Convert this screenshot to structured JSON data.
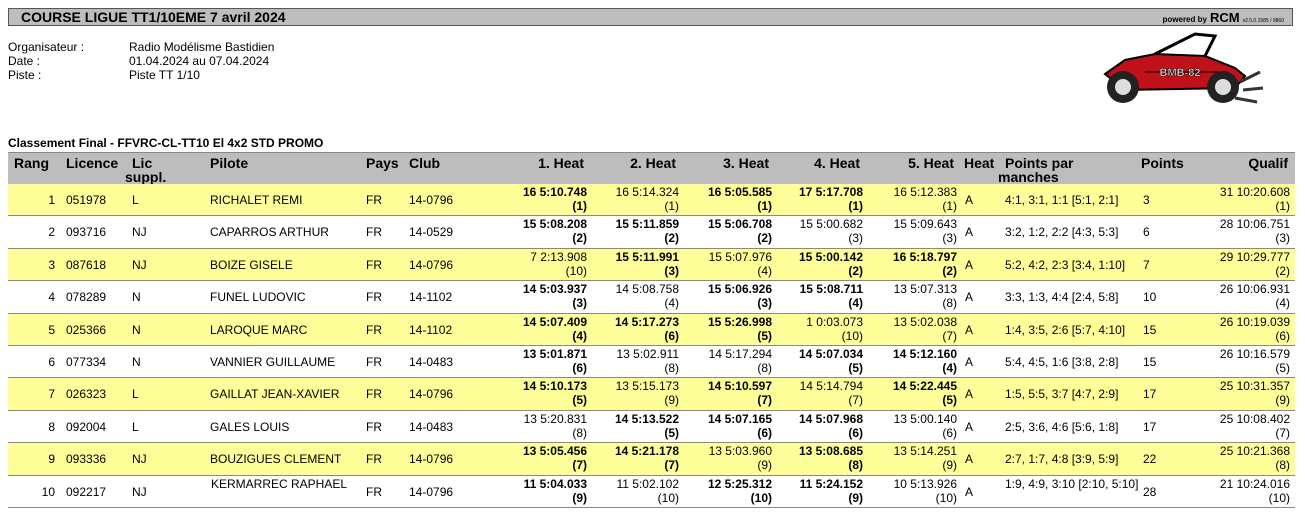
{
  "header": {
    "title": "COURSE LIGUE TT1/10EME 7 avril 2024",
    "powered_by": "powered by",
    "brand": "RCM",
    "version": "v2.5.0.1585 / 9860"
  },
  "info": {
    "organisateur_label": "Organisateur :",
    "organisateur": "Radio Modélisme Bastidien",
    "date_label": "Date :",
    "date": "01.04.2024 au 07.04.2024",
    "piste_label": "Piste :",
    "piste": "Piste TT 1/10"
  },
  "logo": {
    "text": "BMB-82"
  },
  "subtitle": "Classement Final  -  FFVRC-CL-TT10 El 4x2 STD PROMO",
  "columns": {
    "rang": "Rang",
    "licence": "Licence",
    "lic_suppl_1": "Lic",
    "lic_suppl_2": "suppl.",
    "pilote": "Pilote",
    "pays": "Pays",
    "club": "Club",
    "heat1": "1. Heat",
    "heat2": "2. Heat",
    "heat3": "3. Heat",
    "heat4": "4. Heat",
    "heat5": "5. Heat",
    "heat": "Heat",
    "points_par_1": "Points par",
    "points_par_2": "manches",
    "points": "Points",
    "qualif": "Qualif"
  },
  "rows": [
    {
      "rang": "1",
      "licence": "051978",
      "lic": "L",
      "pilote": "RICHALET REMI",
      "pays": "FR",
      "club": "14-0796",
      "heats": [
        [
          "16 5:10.748",
          "(1)"
        ],
        [
          "16 5:14.324",
          "(1)"
        ],
        [
          "16 5:05.585",
          "(1)"
        ],
        [
          "17 5:17.708",
          "(1)"
        ],
        [
          "16 5:12.383",
          "(1)"
        ]
      ],
      "heat": "A",
      "pts": "4:1, 3:1, 1:1 [5:1, 2:1]",
      "points": "3",
      "qualif": [
        "31 10:20.608",
        "(1)"
      ]
    },
    {
      "rang": "2",
      "licence": "093716",
      "lic": "NJ",
      "pilote": "CAPARROS ARTHUR",
      "pays": "FR",
      "club": "14-0529",
      "heats": [
        [
          "15 5:08.208",
          "(2)"
        ],
        [
          "15 5:11.859",
          "(2)"
        ],
        [
          "15 5:06.708",
          "(2)"
        ],
        [
          "15 5:00.682",
          "(3)"
        ],
        [
          "15 5:09.643",
          "(3)"
        ]
      ],
      "heat": "A",
      "pts": "3:2, 1:2, 2:2 [4:3, 5:3]",
      "points": "6",
      "qualif": [
        "28 10:06.751",
        "(3)"
      ]
    },
    {
      "rang": "3",
      "licence": "087618",
      "lic": "NJ",
      "pilote": "BOIZE GISELE",
      "pays": "FR",
      "club": "14-0796",
      "heats": [
        [
          "7 2:13.908",
          "(10)"
        ],
        [
          "15 5:11.991",
          "(3)"
        ],
        [
          "15 5:07.976",
          "(4)"
        ],
        [
          "15 5:00.142",
          "(2)"
        ],
        [
          "16 5:18.797",
          "(2)"
        ]
      ],
      "heat": "A",
      "pts": "5:2, 4:2, 2:3 [3:4, 1:10]",
      "points": "7",
      "qualif": [
        "29 10:29.777",
        "(2)"
      ]
    },
    {
      "rang": "4",
      "licence": "078289",
      "lic": "N",
      "pilote": "FUNEL LUDOVIC",
      "pays": "FR",
      "club": "14-1102",
      "heats": [
        [
          "14 5:03.937",
          "(3)"
        ],
        [
          "14 5:08.758",
          "(4)"
        ],
        [
          "15 5:06.926",
          "(3)"
        ],
        [
          "15 5:08.711",
          "(4)"
        ],
        [
          "13 5:07.313",
          "(8)"
        ]
      ],
      "heat": "A",
      "pts": "3:3, 1:3, 4:4 [2:4, 5:8]",
      "points": "10",
      "qualif": [
        "26 10:06.931",
        "(4)"
      ]
    },
    {
      "rang": "5",
      "licence": "025366",
      "lic": "N",
      "pilote": "LAROQUE MARC",
      "pays": "FR",
      "club": "14-1102",
      "heats": [
        [
          "14 5:07.409",
          "(4)"
        ],
        [
          "14 5:17.273",
          "(6)"
        ],
        [
          "15 5:26.998",
          "(5)"
        ],
        [
          "1 0:03.073",
          "(10)"
        ],
        [
          "13 5:02.038",
          "(7)"
        ]
      ],
      "heat": "A",
      "pts": "1:4, 3:5, 2:6 [5:7, 4:10]",
      "points": "15",
      "qualif": [
        "26 10:19.039",
        "(6)"
      ]
    },
    {
      "rang": "6",
      "licence": "077334",
      "lic": "N",
      "pilote": "VANNIER GUILLAUME",
      "pays": "FR",
      "club": "14-0483",
      "heats": [
        [
          "13 5:01.871",
          "(6)"
        ],
        [
          "13 5:02.911",
          "(8)"
        ],
        [
          "14 5:17.294",
          "(8)"
        ],
        [
          "14 5:07.034",
          "(5)"
        ],
        [
          "14 5:12.160",
          "(4)"
        ]
      ],
      "heat": "A",
      "pts": "5:4, 4:5, 1:6 [3:8, 2:8]",
      "points": "15",
      "qualif": [
        "26 10:16.579",
        "(5)"
      ]
    },
    {
      "rang": "7",
      "licence": "026323",
      "lic": "L",
      "pilote": "GAILLAT JEAN-XAVIER",
      "pays": "FR",
      "club": "14-0796",
      "heats": [
        [
          "14 5:10.173",
          "(5)"
        ],
        [
          "13 5:15.173",
          "(9)"
        ],
        [
          "14 5:10.597",
          "(7)"
        ],
        [
          "14 5:14.794",
          "(7)"
        ],
        [
          "14 5:22.445",
          "(5)"
        ]
      ],
      "heat": "A",
      "pts": "1:5, 5:5, 3:7 [4:7, 2:9]",
      "points": "17",
      "qualif": [
        "25 10:31.357",
        "(9)"
      ]
    },
    {
      "rang": "8",
      "licence": "092004",
      "lic": "L",
      "pilote": "GALES LOUIS",
      "pays": "FR",
      "club": "14-0483",
      "heats": [
        [
          "13 5:20.831",
          "(8)"
        ],
        [
          "14 5:13.522",
          "(5)"
        ],
        [
          "14 5:07.165",
          "(6)"
        ],
        [
          "14 5:07.968",
          "(6)"
        ],
        [
          "13 5:00.140",
          "(6)"
        ]
      ],
      "heat": "A",
      "pts": "2:5, 3:6, 4:6 [5:6, 1:8]",
      "points": "17",
      "qualif": [
        "25 10:08.402",
        "(7)"
      ]
    },
    {
      "rang": "9",
      "licence": "093336",
      "lic": "NJ",
      "pilote": "BOUZIGUES CLEMENT",
      "pays": "FR",
      "club": "14-0796",
      "heats": [
        [
          "13 5:05.456",
          "(7)"
        ],
        [
          "14 5:21.178",
          "(7)"
        ],
        [
          "13 5:03.960",
          "(9)"
        ],
        [
          "13 5:08.685",
          "(8)"
        ],
        [
          "13 5:14.251",
          "(9)"
        ]
      ],
      "heat": "A",
      "pts": "2:7, 1:7, 4:8 [3:9, 5:9]",
      "points": "22",
      "qualif": [
        "25 10:21.368",
        "(8)"
      ]
    },
    {
      "rang": "10",
      "licence": "092217",
      "lic": "NJ",
      "pilote": "KERMARREC RAPHAEL",
      "pilote_l1": "KERMARREC",
      "pilote_l2": "RAPHAEL",
      "pays": "FR",
      "club": "14-0796",
      "heats": [
        [
          "11 5:04.033",
          "(9)"
        ],
        [
          "11 5:02.102",
          "(10)"
        ],
        [
          "12 5:25.312",
          "(10)"
        ],
        [
          "11 5:24.152",
          "(9)"
        ],
        [
          "10 5:13.926",
          "(10)"
        ]
      ],
      "heat": "A",
      "pts": "1:9, 4:9, 3:10 [2:10, 5:10]",
      "points": "28",
      "qualif": [
        "21 10:24.016",
        "(10)"
      ]
    }
  ],
  "bold_heats": [
    [
      true,
      false,
      true,
      true,
      false
    ],
    [
      true,
      true,
      true,
      false,
      false
    ],
    [
      false,
      true,
      false,
      true,
      true
    ],
    [
      true,
      false,
      true,
      true,
      false
    ],
    [
      true,
      true,
      true,
      false,
      false
    ],
    [
      true,
      false,
      false,
      true,
      true
    ],
    [
      true,
      false,
      true,
      false,
      true
    ],
    [
      false,
      true,
      true,
      true,
      false
    ],
    [
      true,
      true,
      false,
      true,
      false
    ],
    [
      true,
      false,
      true,
      true,
      false
    ]
  ]
}
